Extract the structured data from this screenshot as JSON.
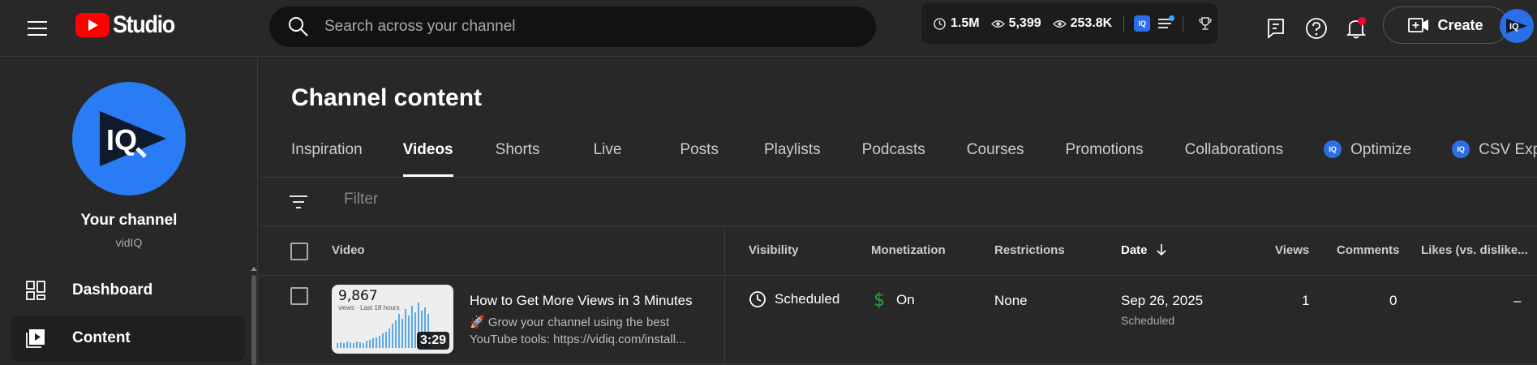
{
  "header": {
    "logo_text": "Studio",
    "search_placeholder": "Search across your channel",
    "stats": {
      "subscribers": "1.5M",
      "views_a": "5,399",
      "views_b": "253.8K"
    },
    "iq_badge": "IQ",
    "create_label": "Create"
  },
  "sidebar": {
    "channel_title": "Your channel",
    "channel_name": "vidIQ",
    "items": [
      {
        "label": "Dashboard"
      },
      {
        "label": "Content"
      }
    ]
  },
  "main": {
    "title": "Channel content",
    "tabs": [
      {
        "label": "Inspiration"
      },
      {
        "label": "Videos"
      },
      {
        "label": "Shorts"
      },
      {
        "label": "Live"
      },
      {
        "label": "Posts"
      },
      {
        "label": "Playlists"
      },
      {
        "label": "Podcasts"
      },
      {
        "label": "Courses"
      },
      {
        "label": "Promotions"
      },
      {
        "label": "Collaborations"
      },
      {
        "label": "Optimize"
      },
      {
        "label": "CSV Expo"
      }
    ],
    "filter_placeholder": "Filter",
    "columns": {
      "video": "Video",
      "visibility": "Visibility",
      "monetization": "Monetization",
      "restrictions": "Restrictions",
      "date": "Date",
      "views": "Views",
      "comments": "Comments",
      "likes": "Likes (vs. dislike..."
    },
    "rows": [
      {
        "thumb_count": "9,867",
        "thumb_caption": "views · Last 18 hours",
        "duration": "3:29",
        "title": "How to Get More Views in 3 Minutes",
        "description": "🚀 Grow your channel using the best YouTube tools: https://vidiq.com/install...",
        "visibility": "Scheduled",
        "monetization": "On",
        "restrictions": "None",
        "date": "Sep 26, 2025",
        "date_status": "Scheduled",
        "views": "1",
        "comments": "0",
        "likes": "–"
      }
    ]
  },
  "colors": {
    "background": "#282828",
    "search_bg": "#121212",
    "brand_red": "#ff0000",
    "vidiq_blue": "#2a7cf5",
    "monetization_green": "#2ba640",
    "notification_red": "#ff0033"
  },
  "icons": {
    "menu": "hamburger-icon",
    "search": "search-icon",
    "subscribers": "clock-icon",
    "views": "eye-icon",
    "list": "list-icon",
    "trophy": "trophy-icon",
    "feedback": "feedback-icon",
    "help": "help-icon",
    "notifications": "bell-icon",
    "create": "create-video-icon",
    "dashboard": "dashboard-icon",
    "content": "content-icon",
    "filter": "filter-icon",
    "sort": "arrow-down-icon",
    "visibility": "clock-icon",
    "monetization": "dollar-icon"
  }
}
